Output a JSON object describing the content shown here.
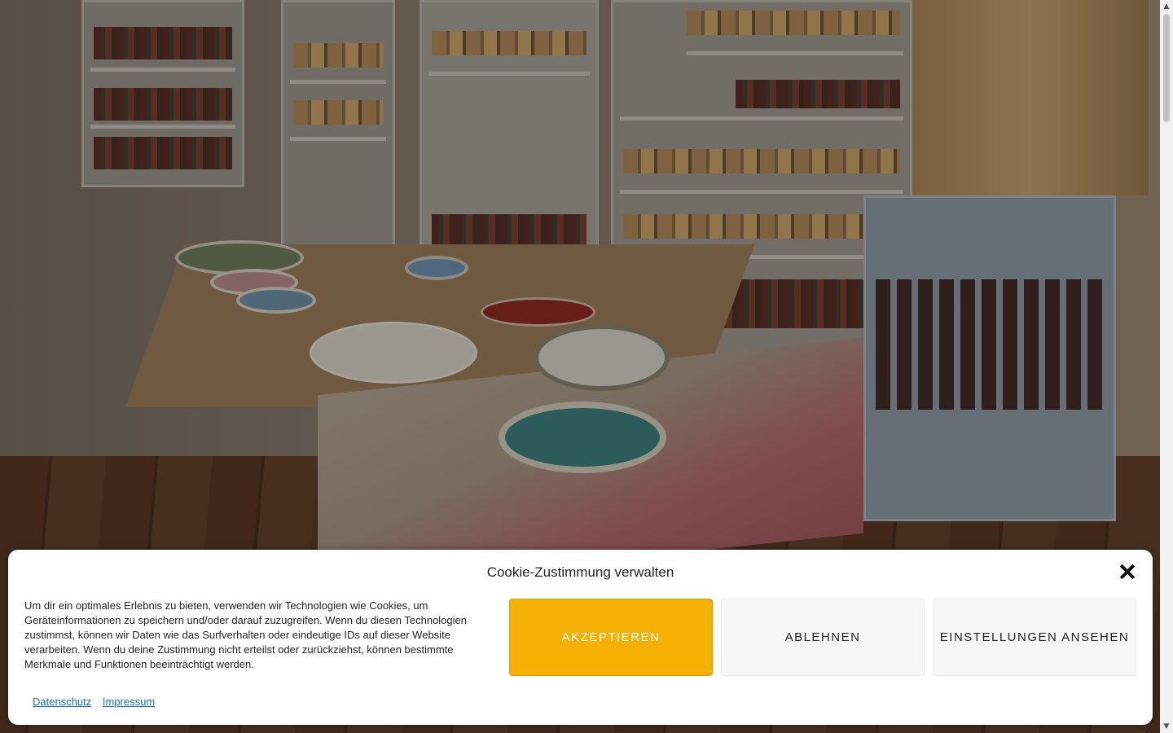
{
  "cookie_banner": {
    "title": "Cookie-Zustimmung verwalten",
    "text": "Um dir ein optimales Erlebnis zu bieten, verwenden wir Technologien wie Cookies, um Geräteinformationen zu speichern und/oder darauf zuzugreifen. Wenn du diesen Technologien zustimmst, können wir Daten wie das Surfverhalten oder eindeutige IDs auf dieser Website verarbeiten. Wenn du deine Zustimmung nicht erteilst oder zurückziehst, können bestimmte Merkmale und Funktionen beeinträchtigt werden.",
    "accept_label": "AKZEPTIEREN",
    "deny_label": "ABLEHNEN",
    "view_preferences_label": "EINSTELLUNGEN ANSEHEN",
    "links": {
      "privacy": "Datenschutz",
      "imprint": "Impressum"
    }
  },
  "colors": {
    "accent": "#f5b003",
    "link": "#1d6fa5",
    "secondary_button": "#f7f7f7"
  },
  "icons": {
    "close": "close-icon"
  }
}
